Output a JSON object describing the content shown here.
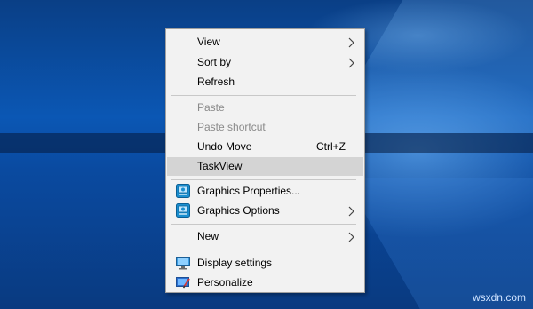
{
  "menu": {
    "items": [
      {
        "label": "View",
        "submenu": true
      },
      {
        "label": "Sort by",
        "submenu": true
      },
      {
        "label": "Refresh"
      },
      {
        "label": "Paste",
        "disabled": true
      },
      {
        "label": "Paste shortcut",
        "disabled": true
      },
      {
        "label": "Undo Move",
        "shortcut": "Ctrl+Z"
      },
      {
        "label": "TaskView",
        "highlighted": true
      },
      {
        "label": "Graphics Properties...",
        "icon": "intel-graphics-icon"
      },
      {
        "label": "Graphics Options",
        "icon": "intel-graphics-icon",
        "submenu": true
      },
      {
        "label": "New",
        "submenu": true
      },
      {
        "label": "Display settings",
        "icon": "display-icon"
      },
      {
        "label": "Personalize",
        "icon": "personalize-icon"
      }
    ]
  },
  "watermark": "wsxdn.com",
  "colors": {
    "menu_bg": "#f2f2f2",
    "highlight": "#d4d4d4",
    "disabled_text": "#8a8a8a",
    "desktop_blue": "#0b57b4"
  }
}
